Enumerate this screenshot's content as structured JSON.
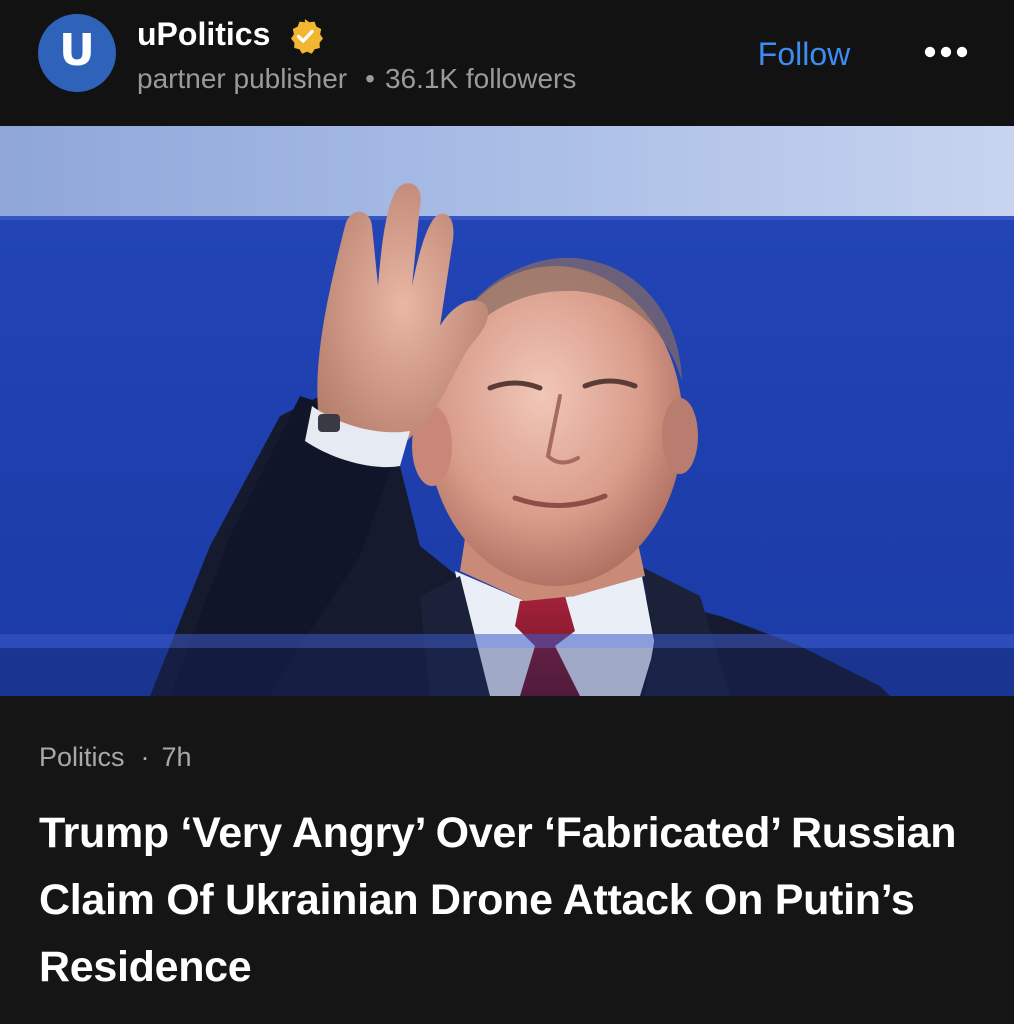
{
  "publisher": {
    "avatar_letter": "U",
    "name": "uPolitics",
    "type": "partner publisher",
    "followers": "36.1K followers",
    "verified": true
  },
  "header": {
    "follow_label": "Follow",
    "more_icon": "more-horizontal-icon"
  },
  "article": {
    "category": "Politics",
    "separator": "·",
    "age": "7h",
    "headline": "Trump ‘Very Angry’ Over ‘Fabricated’ Russian Claim Of Ukrainian Drone Attack On Putin’s Residence"
  },
  "colors": {
    "background": "#141414",
    "accent_link": "#3d8cf0",
    "avatar": "#2f63b9",
    "verified_badge": "#f2b632",
    "hero_backdrop": "#1f3fb3",
    "muted_text": "#9a9a9a"
  }
}
